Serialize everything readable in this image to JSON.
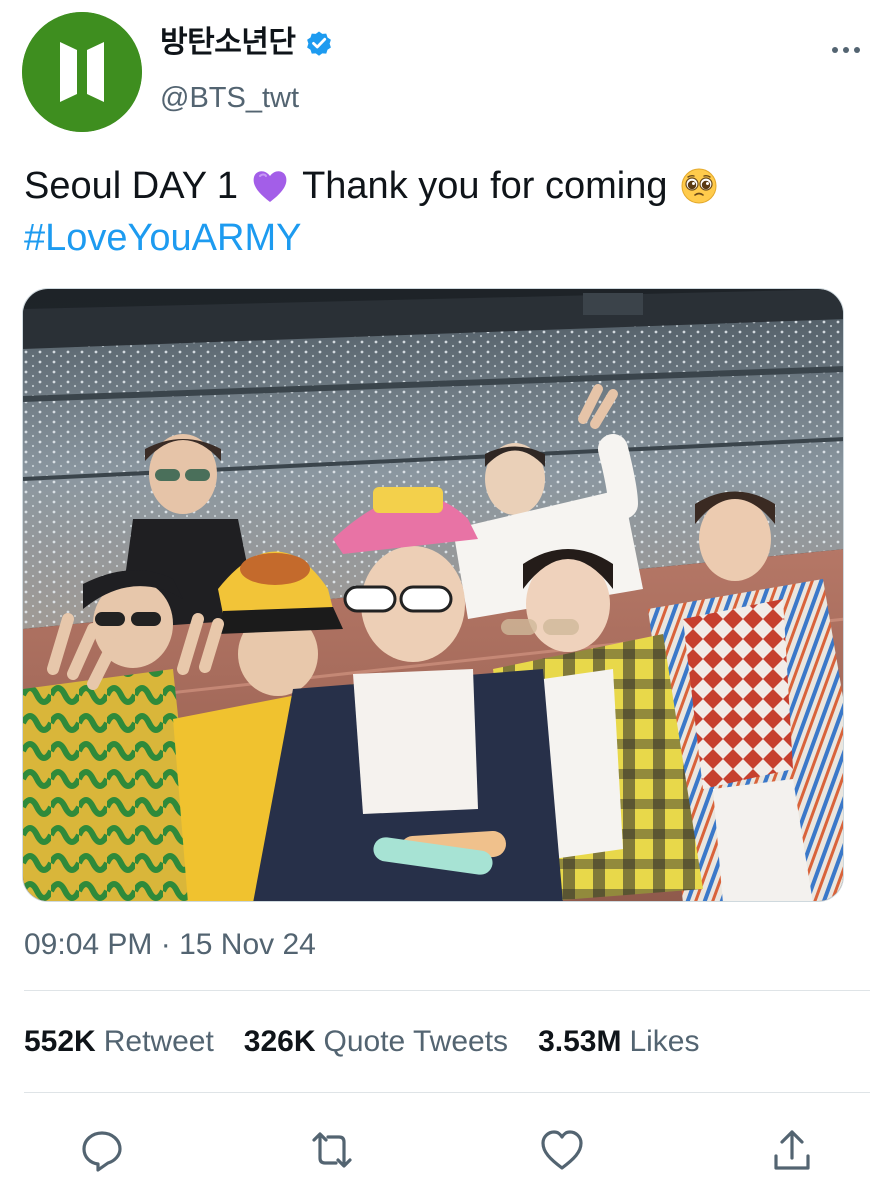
{
  "author": {
    "display_name": "방탄소년단",
    "handle": "@BTS_twt",
    "verified": true,
    "avatar_color": "#3e8e1f"
  },
  "tweet": {
    "text_part1": "Seoul DAY 1",
    "emoji1": "purple-heart",
    "text_part2": "Thank you for coming",
    "emoji2": "pleading-face",
    "hashtag": "#LoveYouARMY"
  },
  "meta": {
    "timestamp": "09:04 PM · 15 Nov 24"
  },
  "stats": {
    "retweets_count": "552K",
    "retweets_label": "Retweet",
    "quotes_count": "326K",
    "quotes_label": "Quote Tweets",
    "likes_count": "3.53M",
    "likes_label": "Likes"
  },
  "actions": [
    "reply-icon",
    "retweet-icon",
    "like-icon",
    "share-icon"
  ],
  "colors": {
    "link": "#1d9bf0",
    "secondary_text": "#536471",
    "verified": "#1d9bf0"
  }
}
